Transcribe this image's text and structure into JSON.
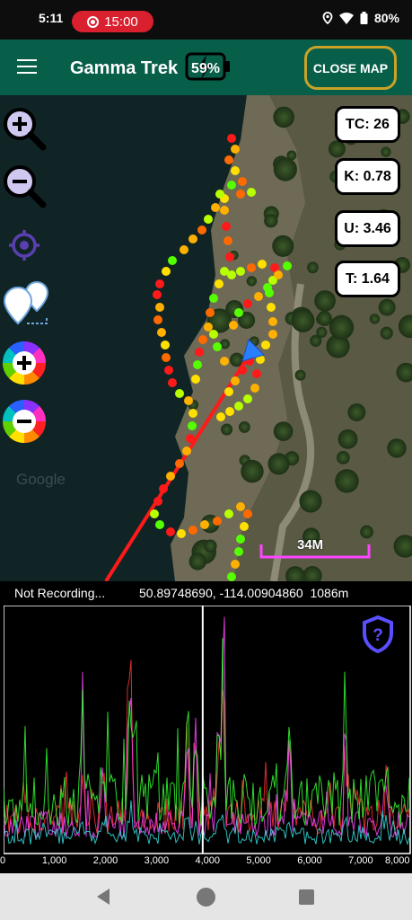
{
  "status_bar": {
    "time": "5:11",
    "recording_timer": "15:00",
    "battery": "80%",
    "icons": [
      "record-icon",
      "location-icon",
      "wifi-icon",
      "battery-icon"
    ]
  },
  "app_bar": {
    "title": "Gamma Trek",
    "device_battery": "59%",
    "close_map_label": "CLOSE MAP"
  },
  "map": {
    "tools": [
      "zoom-in-icon",
      "zoom-out-icon",
      "center-location-icon",
      "waypoints-icon",
      "color-scale-add-icon",
      "color-scale-remove-icon"
    ],
    "stats": {
      "tc": "TC: 26",
      "k": "K: 0.78",
      "u": "U: 3.46",
      "t": "T: 1.64"
    },
    "scale_label": "34M",
    "watermark": "Google",
    "track_colors": [
      "#ff1a1a",
      "#ff6a00",
      "#ffb000",
      "#ffe000",
      "#b8ff00",
      "#55ff00"
    ]
  },
  "gps": {
    "recording_state": "Not Recording...",
    "coordinates": "50.89748690, -114.00904860",
    "altitude": "1086m"
  },
  "spectrum": {
    "x_ticks": [
      "0",
      "1,000",
      "2,000",
      "3,000",
      "4,000",
      "5,000",
      "6,000",
      "7,000",
      "8,000"
    ],
    "x_max": 8000,
    "marker_x": 3900,
    "series_colors": [
      "#ff3333",
      "#ff44ff",
      "#33ff33",
      "#33dddd"
    ],
    "help_icon": "shield-question-icon"
  },
  "nav_bar": {
    "icons": [
      "back-icon",
      "home-icon",
      "recents-icon"
    ]
  }
}
